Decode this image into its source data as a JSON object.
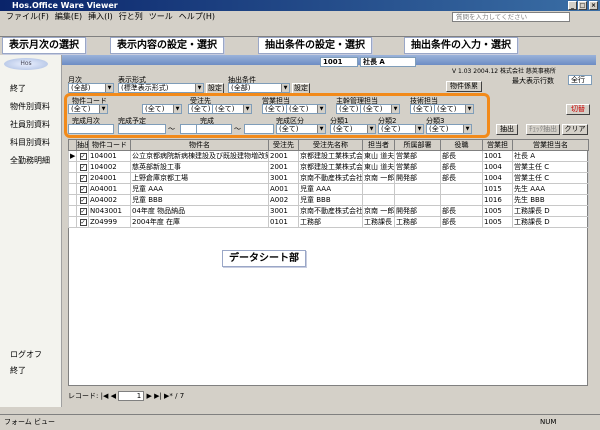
{
  "window": {
    "title": "Hos.Office Ware Viewer",
    "help_placeholder": "質問を入力してください"
  },
  "menu": [
    "ファイル(F)",
    "編集(E)",
    "挿入(I)",
    "行と列",
    "ツール",
    "ヘルプ(H)"
  ],
  "callouts": {
    "month": "表示月次の選択",
    "content": "表示内容の設定・選択",
    "extract_set": "抽出条件の設定・選択",
    "extract_input": "抽出条件の入力・選択",
    "datasheet": "データシート部"
  },
  "sidebar": {
    "logo": "Hos",
    "items": [
      "終了",
      "物件別資料",
      "社員別資料",
      "科目別資料",
      "全勤務明細"
    ],
    "logoff": "ログオフ",
    "exit": "終了"
  },
  "header": {
    "number": "1001",
    "company": "社長 A",
    "version": "V 1.03 2004.12 株式会社 慈英事務所",
    "max_rows_label": "最大表示行数",
    "max_rows_value": "全行"
  },
  "top": {
    "month_label": "月次",
    "month_value": "(全部)",
    "format_label": "表示形式",
    "format_value": "(標準表示形式)",
    "set_btn": "設定",
    "cond_label": "抽出条件",
    "cond_value": "(全部)",
    "set2_btn": "設定",
    "prop_btn": "物件係累"
  },
  "filters": {
    "row1": [
      "物件コード",
      "受注先",
      "営業担当",
      "主幹管理担当",
      "技術担当"
    ],
    "all": "(全て)",
    "tilde": "〜",
    "row2": [
      "完成月次",
      "完成予定",
      "完成",
      "完成区分",
      "分類1",
      "分類2",
      "分類3"
    ],
    "switch_btn": "切替",
    "extract_btn": "抽出",
    "check_btn": "ﾁｪｯｸ抽出",
    "clear_btn": "クリア"
  },
  "table": {
    "headers": [
      "抽出",
      "物件コード",
      "物件名",
      "受注先",
      "受注先名称",
      "担当者",
      "所属部署",
      "役職",
      "営業担",
      "営業担当名"
    ],
    "rows": [
      [
        "104001",
        "公立京都病院新病棟建設及び既設建物増改築",
        "2001",
        "京都建設工業株式会社",
        "東山 道夫",
        "営業部",
        "部長",
        "1001",
        "社長 A"
      ],
      [
        "104002",
        "慈英部新設工事",
        "2001",
        "京都建設工業株式会社",
        "東山 道夫",
        "営業部",
        "部長",
        "1004",
        "営業主任 C"
      ],
      [
        "204001",
        "上野倉庫京都工場",
        "3001",
        "京南不動産株式会社",
        "京南 一郎",
        "開発部",
        "部長",
        "1004",
        "営業主任 C"
      ],
      [
        "A04001",
        "児童 AAA",
        "A001",
        "児童 AAA",
        "",
        "",
        "",
        "1015",
        "先生 AAA"
      ],
      [
        "A04002",
        "児童 BBB",
        "A002",
        "児童 BBB",
        "",
        "",
        "",
        "1016",
        "先生 BBB"
      ],
      [
        "N043001",
        "04年度 物品納品",
        "3001",
        "京南不動産株式会社",
        "京南 一郎",
        "開発部",
        "部長",
        "1005",
        "工務課長 D"
      ],
      [
        "Z04999",
        "2004年度 在庫",
        "0101",
        "工務部",
        "工務課長 D",
        "工務部",
        "部長",
        "1005",
        "工務課長 D"
      ]
    ]
  },
  "nav": {
    "label": "レコード:",
    "current": "1",
    "total": "/ 7"
  },
  "status": {
    "left": "フォーム ビュー",
    "right": "NUM"
  }
}
